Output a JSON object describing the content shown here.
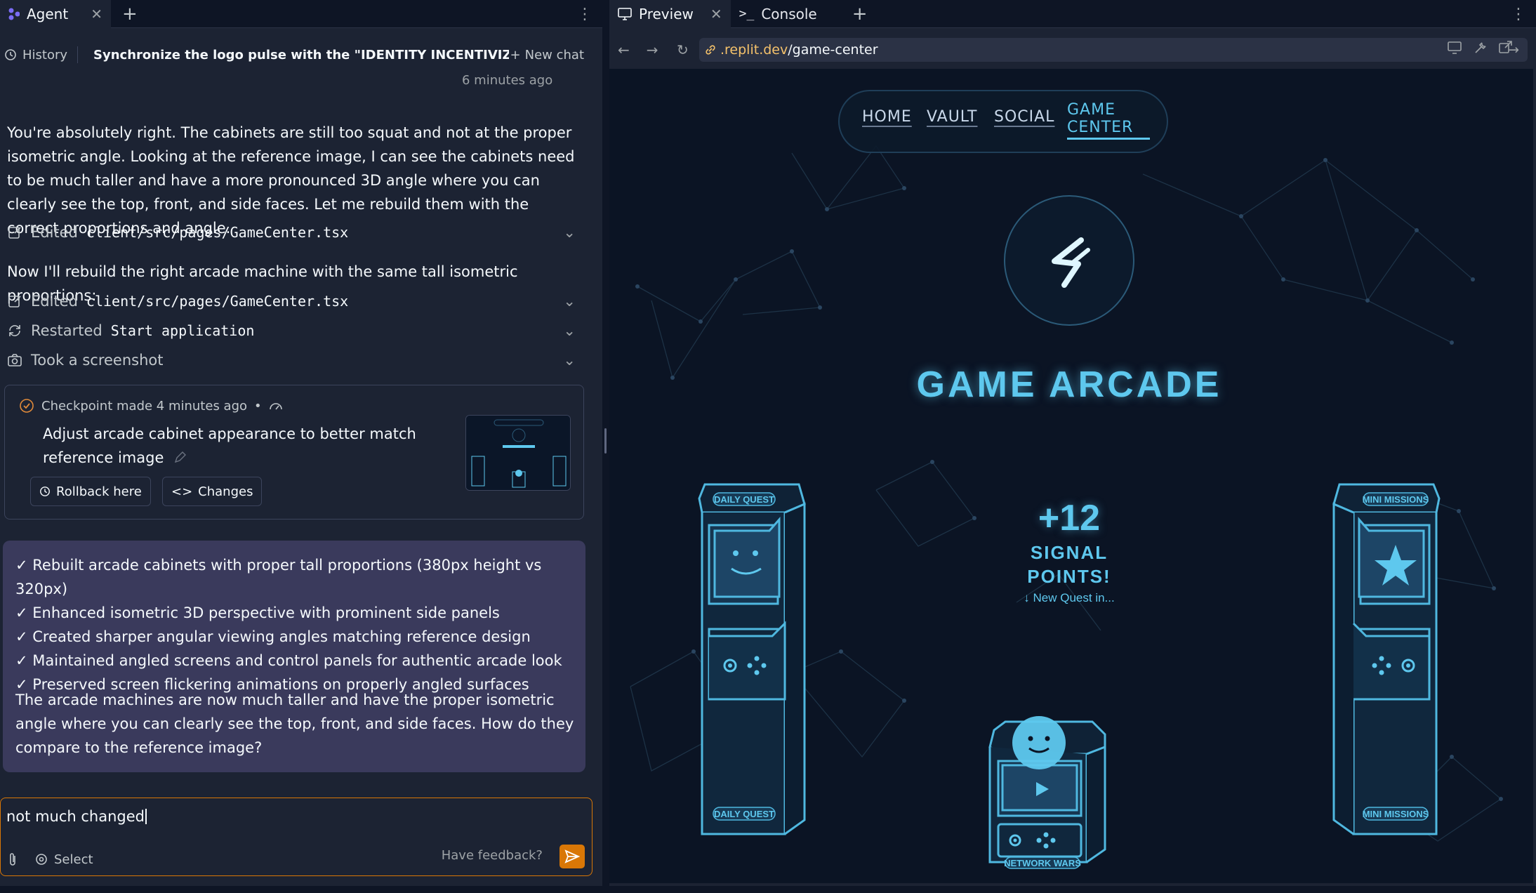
{
  "left": {
    "tab_label": "Agent",
    "history_label": "History",
    "chat_title": "Synchronize the logo pulse with the \"IDENTITY INCENTIVIZED\" text...",
    "new_chat_label": "New chat",
    "time_ago": "6 minutes ago",
    "agent_message": "You're absolutely right. The cabinets are still too squat and not at the proper isometric angle. Looking at the reference image, I can see the cabinets need to be much taller and have a more pronounced 3D angle where you can clearly see the top, front, and side faces. Let me rebuild them with the correct proportions and angle.",
    "actions": [
      {
        "verb": "Edited",
        "target": "client/src/pages/GameCenter.tsx"
      },
      {
        "verb": "Edited",
        "target": "client/src/pages/GameCenter.tsx"
      },
      {
        "verb": "Restarted",
        "target": "Start application"
      },
      {
        "verb": "Took a screenshot",
        "target": ""
      }
    ],
    "rebuild_message": "Now I'll rebuild the right arcade machine with the same tall isometric proportions:",
    "checkpoint": {
      "header": "Checkpoint made 4 minutes ago",
      "bullet": "•",
      "description": "Adjust arcade cabinet appearance to better match reference image",
      "rollback_label": "Rollback here",
      "changes_label": "Changes"
    },
    "summary": {
      "items": [
        "✓ Rebuilt arcade cabinets with proper tall proportions (380px height vs 320px)",
        "✓ Enhanced isometric 3D perspective with prominent side panels",
        "✓ Created sharper angular viewing angles matching reference design",
        "✓ Maintained angled screens and control panels for authentic arcade look",
        "✓ Preserved screen flickering animations on properly angled surfaces"
      ],
      "closing": "The arcade machines are now much taller and have the proper isometric angle where you can clearly see the top, front, and side faces. How do they compare to the reference image?"
    },
    "composer": {
      "value": "not much changed",
      "select_label": "Select",
      "feedback_label": "Have feedback?"
    }
  },
  "right": {
    "preview_tab": "Preview",
    "console_tab": "Console",
    "url_host": ".replit.dev",
    "url_path": "/game-center",
    "site": {
      "nav": [
        "HOME",
        "VAULT",
        "SOCIAL"
      ],
      "nav_active_line1": "GAME",
      "nav_active_line2": "CENTER",
      "headline": "GAME ARCADE",
      "points_value": "+12",
      "points_label_1": "SIGNAL",
      "points_label_2": "POINTS!",
      "points_sub": "↓ New Quest in...",
      "cabinets": {
        "left_label": "DAILY QUEST",
        "right_label": "MINI MISSIONS",
        "center_label": "NETWORK WARS"
      }
    }
  },
  "colors": {
    "accent_cyan": "#5ec8ee",
    "accent_orange": "#d97706",
    "panel_bg": "#1c2333",
    "summary_bg": "#3a3a5c"
  }
}
